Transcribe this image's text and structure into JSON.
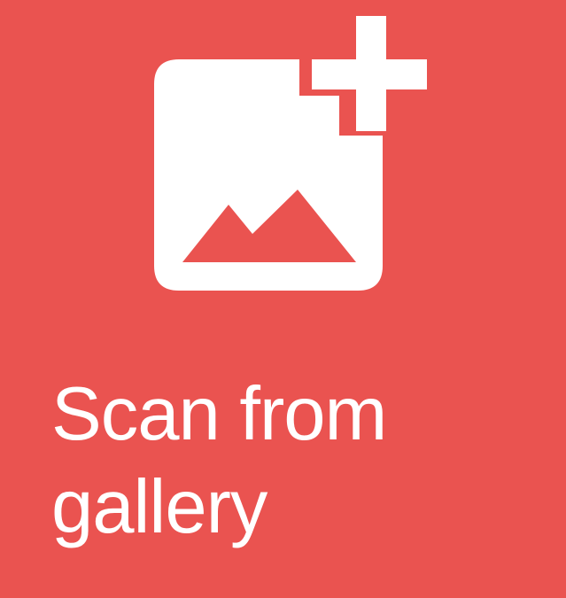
{
  "tile": {
    "background_color": "#ea5350",
    "foreground_color": "#ffffff",
    "icon": "add-photo-icon",
    "label_line1": "Scan from",
    "label_line2": "gallery"
  }
}
